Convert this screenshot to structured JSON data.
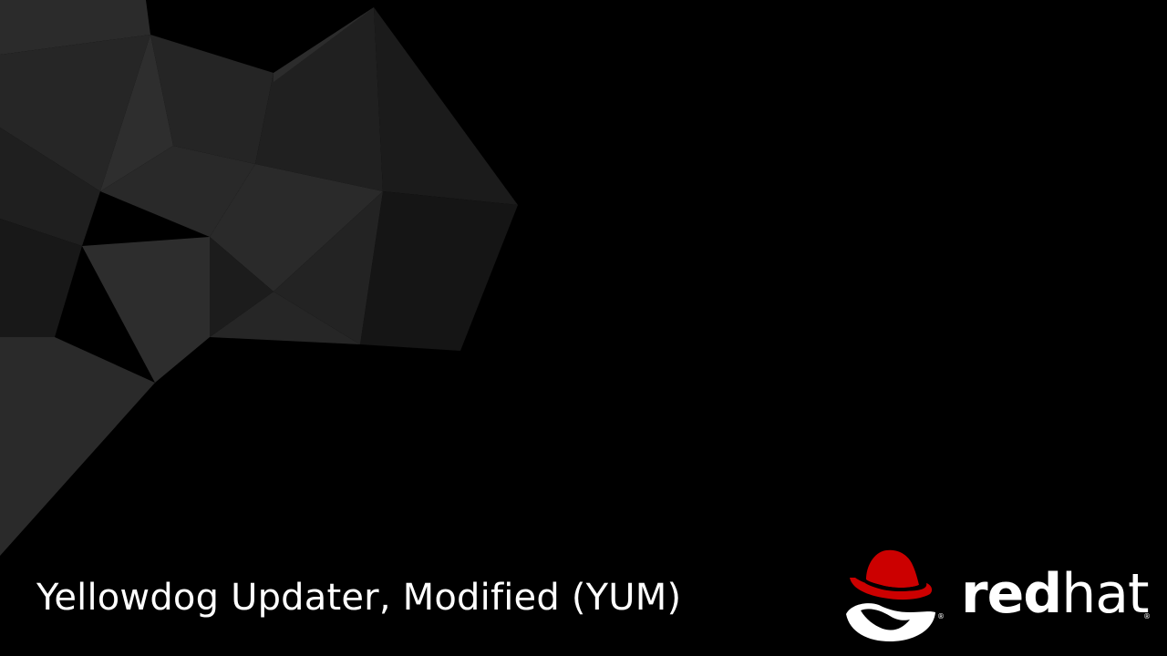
{
  "slide": {
    "title": "Yellowdog Updater, Modified (YUM)"
  },
  "logo": {
    "word_bold": "red",
    "word_light": "hat",
    "trademark": "®",
    "hat_color": "#cc0000"
  },
  "colors": {
    "background": "#000000",
    "text": "#ffffff"
  }
}
